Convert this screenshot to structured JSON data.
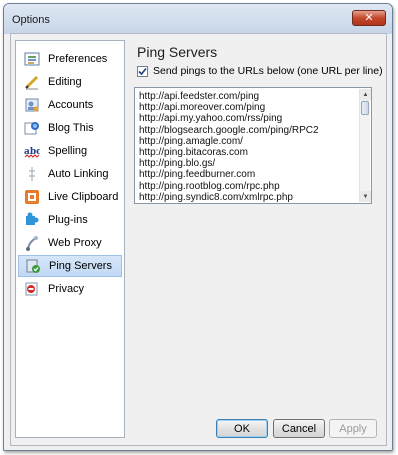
{
  "window": {
    "title": "Options",
    "close_glyph": "✕"
  },
  "sidebar": {
    "items": [
      {
        "label": "Preferences",
        "icon": "preferences-icon"
      },
      {
        "label": "Editing",
        "icon": "pencil-icon"
      },
      {
        "label": "Accounts",
        "icon": "accounts-icon"
      },
      {
        "label": "Blog This",
        "icon": "blog-this-icon"
      },
      {
        "label": "Spelling",
        "icon": "spelling-icon"
      },
      {
        "label": "Auto Linking",
        "icon": "link-icon"
      },
      {
        "label": "Live Clipboard",
        "icon": "clipboard-icon"
      },
      {
        "label": "Plug-ins",
        "icon": "puzzle-icon"
      },
      {
        "label": "Web Proxy",
        "icon": "proxy-icon"
      },
      {
        "label": "Ping Servers",
        "icon": "ping-icon",
        "selected": true
      },
      {
        "label": "Privacy",
        "icon": "privacy-icon"
      }
    ]
  },
  "content": {
    "title": "Ping Servers",
    "checkbox_label": "Send pings to the URLs below (one URL per line)",
    "checkbox_checked": true,
    "urls": [
      "http://api.feedster.com/ping",
      "http://api.moreover.com/ping",
      "http://api.my.yahoo.com/rss/ping",
      "http://blogsearch.google.com/ping/RPC2",
      "http://ping.amagle.com/",
      "http://ping.bitacoras.com",
      "http://ping.blo.gs/",
      "http://ping.feedburner.com",
      "http://ping.rootblog.com/rpc.php",
      "http://ping.syndic8.com/xmlrpc.php"
    ]
  },
  "buttons": {
    "ok": "OK",
    "cancel": "Cancel",
    "apply": "Apply"
  },
  "colors": {
    "selection": "#c1d9f4",
    "titlebar": "#c6d5e8",
    "close": "#c4482c"
  }
}
